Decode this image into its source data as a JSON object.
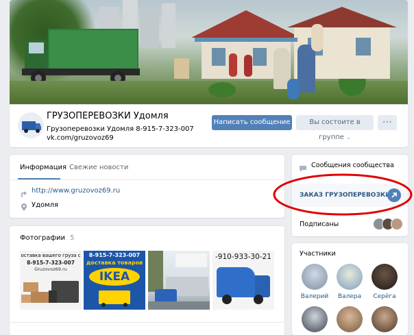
{
  "group": {
    "name": "ГРУЗОПЕРЕВОЗКИ Удомля",
    "status": "Грузоперевозки Удомля 8-915-7-323-007",
    "link": "vk.com/gruzovoz69"
  },
  "actions": {
    "message": "Написать сообщение",
    "member": "Вы состоите в группе",
    "more": "•••"
  },
  "tabs": [
    "Информация",
    "Свежие новости"
  ],
  "info": {
    "website": "http://www.gruzovoz69.ru",
    "city": "Удомля"
  },
  "photos": {
    "title": "Фотографии",
    "count": "5",
    "p1_lines": [
      "оставка вашего груза с",
      "8-915-7-323-007",
      "Gruzovoz69.ru"
    ],
    "p2_lines": [
      "8-915-7-323-007",
      "доставка товаров",
      "IKEA"
    ],
    "p4_text": "-910-933-30-21"
  },
  "right": {
    "messages": "Сообщения сообщества",
    "order": "ЗАКАЗ ГРУЗОПЕРЕВОЗКИ",
    "subscribed": "Подписаны",
    "members_title": "Участники",
    "members": [
      "Валерий",
      "Валера",
      "Серёга"
    ]
  },
  "colors": {
    "accent": "#5181b8",
    "link": "#2a5885",
    "annotation": "#e10000"
  }
}
